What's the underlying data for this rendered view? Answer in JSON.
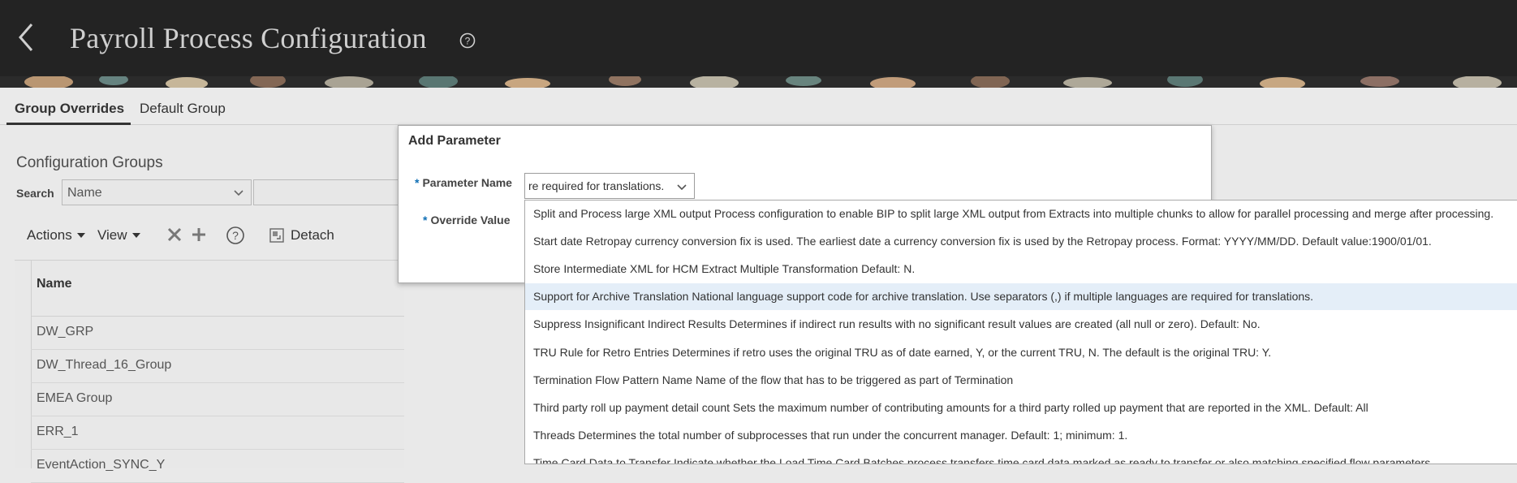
{
  "header": {
    "title": "Payroll Process Configuration"
  },
  "tabs": [
    {
      "label": "Group Overrides",
      "active": true
    },
    {
      "label": "Default Group",
      "active": false
    }
  ],
  "panel": {
    "title": "Configuration Groups",
    "search_label": "Search",
    "search_field_value": "Name",
    "search_input_value": ""
  },
  "toolbar": {
    "actions_label": "Actions",
    "view_label": "View",
    "detach_label": "Detach"
  },
  "table": {
    "header_name": "Name",
    "rows": [
      "DW_GRP",
      "DW_Thread_16_Group",
      "EMEA Group",
      "ERR_1",
      "EventAction_SYNC_Y"
    ]
  },
  "dialog": {
    "title": "Add Parameter",
    "parameter_name_label": "Parameter Name",
    "parameter_name_value": "re required for translations.",
    "override_value_label": "Override Value",
    "required_marker": "*"
  },
  "dropdown": {
    "highlighted_index": 3,
    "items": [
      "Split and Process large XML output Process configuration to enable BIP to split large XML output from Extracts into multiple chunks to allow for parallel processing and merge after processing.",
      "Start date Retropay currency conversion fix is used. The earliest date a currency conversion fix is used by the Retropay process. Format: YYYY/MM/DD. Default value:1900/01/01.",
      "Store Intermediate XML for HCM Extract Multiple Transformation Default: N.",
      "Support for Archive Translation National language support code for archive translation. Use separators (,) if multiple languages are required for translations.",
      "Suppress Insignificant Indirect Results Determines if indirect run results with no significant result values are created (all null or zero). Default: No.",
      "TRU Rule for Retro Entries Determines if retro uses the original TRU as of date earned, Y, or the current TRU, N. The default is the original TRU: Y.",
      "Termination Flow Pattern Name Name of the flow that has to be triggered as part of Termination",
      "Third party roll up payment detail count Sets the maximum number of contributing amounts for a third party rolled up payment that are reported in the XML. Default: All",
      "Threads Determines the total number of subprocesses that run under the concurrent manager. Default: 1; minimum: 1.",
      "Time Card Data to Transfer Indicate whether the Load Time Card Batches process transfers time card data marked as ready to transfer or also matching specified flow parameters."
    ]
  },
  "colors": {
    "header_bg": "#232323",
    "required_marker": "#0f6fb5",
    "highlight_bg": "#e4eef8"
  }
}
